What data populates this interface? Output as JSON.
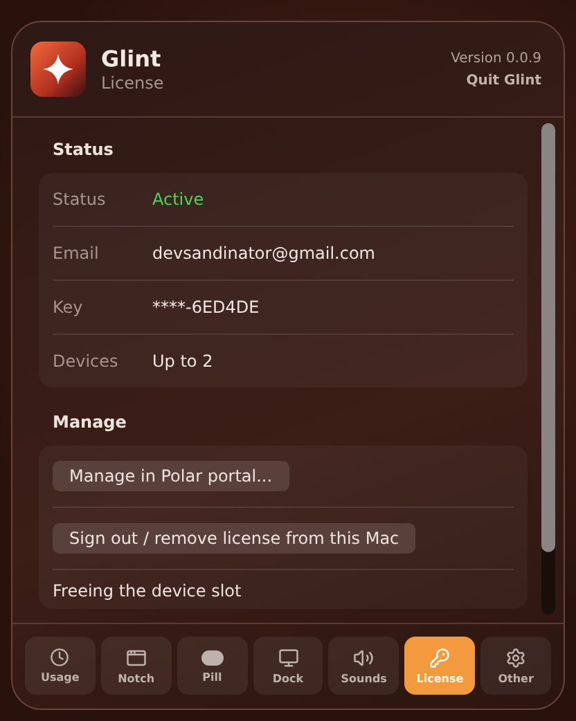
{
  "header": {
    "app_name": "Glint",
    "subtitle": "License",
    "version": "Version 0.0.9",
    "quit": "Quit Glint"
  },
  "status": {
    "heading": "Status",
    "rows": [
      {
        "label": "Status",
        "value": "Active",
        "kind": "status"
      },
      {
        "label": "Email",
        "value": "devsandinator@gmail.com",
        "kind": "text"
      },
      {
        "label": "Key",
        "value": "****-6ED4DE",
        "kind": "text"
      },
      {
        "label": "Devices",
        "value": "Up to 2",
        "kind": "text"
      }
    ]
  },
  "manage": {
    "heading": "Manage",
    "buttons": [
      "Manage in Polar portal...",
      "Sign out / remove license from this Mac"
    ],
    "note": "Freeing the device slot"
  },
  "tabs": [
    {
      "label": "Usage",
      "selected": false
    },
    {
      "label": "Notch",
      "selected": false
    },
    {
      "label": "Pill",
      "selected": false
    },
    {
      "label": "Dock",
      "selected": false
    },
    {
      "label": "Sounds",
      "selected": false
    },
    {
      "label": "License",
      "selected": true
    },
    {
      "label": "Other",
      "selected": false
    }
  ]
}
